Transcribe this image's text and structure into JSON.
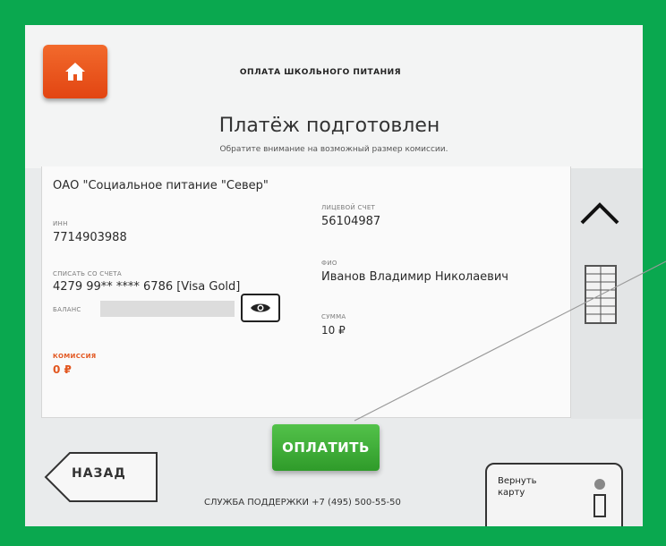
{
  "header": {
    "service_title": "ОПЛАТА ШКОЛЬНОГО ПИТАНИЯ",
    "title": "Платёж подготовлен",
    "notice": "Обратите внимание на возможный размер комиссии."
  },
  "details": {
    "organization": "ОАО \"Социальное питание \"Север\"",
    "inn_label": "ИНН",
    "inn_value": "7714903988",
    "account_label": "ЛИЦЕВОЙ СЧЕТ",
    "account_value": "56104987",
    "debit_label": "СПИСАТЬ СО СЧЕТА",
    "debit_value": "4279 99** **** 6786 [Visa Gold]",
    "name_label": "ФИО",
    "name_value": "Иванов Владимир Николаевич",
    "balance_label": "БАЛАНС",
    "sum_label": "СУММА",
    "sum_value": "10 ₽",
    "commission_label": "КОМИССИЯ",
    "commission_value": "0 ₽"
  },
  "actions": {
    "pay_label": "ОПЛАТИТЬ",
    "back_label": "НАЗАД",
    "return_card_label": "Вернуть карту"
  },
  "footer": {
    "support": "СЛУЖБА ПОДДЕРЖКИ +7 (495) 500-55-50"
  },
  "icons": {
    "home": "home-icon",
    "eye": "eye-icon",
    "scroll_up": "chevron-up-icon",
    "list": "list-icon"
  },
  "colors": {
    "frame": "#0aa84f",
    "home_button": "#e85219",
    "pay_button": "#3fae37",
    "commission": "#e2561f"
  }
}
